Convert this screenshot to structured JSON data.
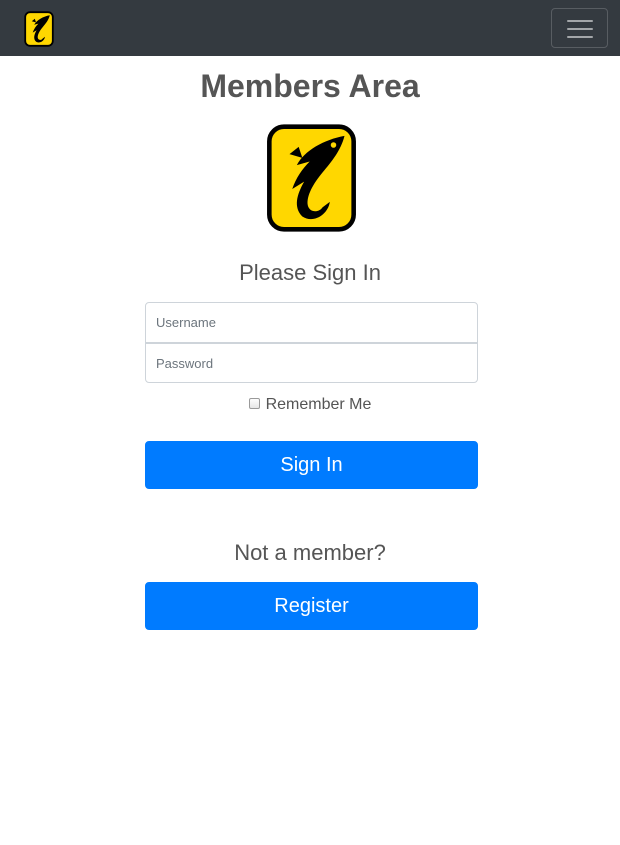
{
  "navbar": {
    "logo_icon": "fish-hook-logo-icon",
    "toggle_icon": "hamburger-menu-icon"
  },
  "page": {
    "title": "Members Area",
    "logo_icon": "fish-hook-logo-icon"
  },
  "signin": {
    "heading": "Please Sign In",
    "username_placeholder": "Username",
    "username_value": "",
    "password_placeholder": "Password",
    "password_value": "",
    "remember_label": "Remember Me",
    "remember_checked": false,
    "button_label": "Sign In"
  },
  "register": {
    "heading": "Not a member?",
    "button_label": "Register"
  },
  "colors": {
    "navbar_bg": "#343a40",
    "primary": "#007bff",
    "logo_yellow": "#ffd700",
    "text": "#555555"
  }
}
